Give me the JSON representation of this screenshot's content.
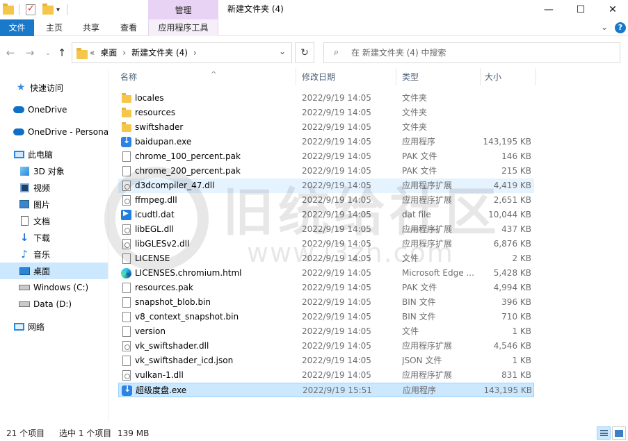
{
  "window": {
    "title": "新建文件夹 (4)",
    "context_tab": "管理",
    "minimize": "—",
    "maximize": "☐",
    "close": "✕"
  },
  "ribbon": {
    "tabs": [
      "文件",
      "主页",
      "共享",
      "查看",
      "应用程序工具"
    ],
    "expand_icon": "chevron-down-icon",
    "help_label": "?"
  },
  "address": {
    "crumbs": [
      "«",
      "桌面",
      "›",
      "新建文件夹 (4)",
      "›"
    ],
    "search_placeholder": "在 新建文件夹 (4) 中搜索"
  },
  "nav": {
    "items": [
      {
        "label": "快速访问",
        "icon": "star-icon"
      },
      {
        "label": "OneDrive",
        "icon": "cloud-icon"
      },
      {
        "label": "OneDrive - Persona",
        "icon": "cloud-icon"
      },
      {
        "label": "此电脑",
        "icon": "computer-icon"
      },
      {
        "label": "3D 对象",
        "icon": "cube-icon"
      },
      {
        "label": "视频",
        "icon": "video-icon"
      },
      {
        "label": "图片",
        "icon": "picture-icon"
      },
      {
        "label": "文档",
        "icon": "document-icon"
      },
      {
        "label": "下载",
        "icon": "download-icon"
      },
      {
        "label": "音乐",
        "icon": "music-icon"
      },
      {
        "label": "桌面",
        "icon": "desktop-icon"
      },
      {
        "label": "Windows (C:)",
        "icon": "drive-icon"
      },
      {
        "label": "Data (D:)",
        "icon": "drive-icon"
      },
      {
        "label": "网络",
        "icon": "network-icon"
      }
    ],
    "selected": "桌面"
  },
  "columns": {
    "name": "名称",
    "date": "修改日期",
    "type": "类型",
    "size": "大小"
  },
  "files": [
    {
      "name": "locales",
      "date": "2022/9/19 14:05",
      "type": "文件夹",
      "size": "",
      "icon": "folder"
    },
    {
      "name": "resources",
      "date": "2022/9/19 14:05",
      "type": "文件夹",
      "size": "",
      "icon": "folder"
    },
    {
      "name": "swiftshader",
      "date": "2022/9/19 14:05",
      "type": "文件夹",
      "size": "",
      "icon": "folder"
    },
    {
      "name": "baidupan.exe",
      "date": "2022/9/19 14:05",
      "type": "应用程序",
      "size": "143,195 KB",
      "icon": "exe"
    },
    {
      "name": "chrome_100_percent.pak",
      "date": "2022/9/19 14:05",
      "type": "PAK 文件",
      "size": "146 KB",
      "icon": "file"
    },
    {
      "name": "chrome_200_percent.pak",
      "date": "2022/9/19 14:05",
      "type": "PAK 文件",
      "size": "215 KB",
      "icon": "file"
    },
    {
      "name": "d3dcompiler_47.dll",
      "date": "2022/9/19 14:05",
      "type": "应用程序扩展",
      "size": "4,419 KB",
      "icon": "dll"
    },
    {
      "name": "ffmpeg.dll",
      "date": "2022/9/19 14:05",
      "type": "应用程序扩展",
      "size": "2,651 KB",
      "icon": "dll"
    },
    {
      "name": "icudtl.dat",
      "date": "2022/9/19 14:05",
      "type": "dat file",
      "size": "10,044 KB",
      "icon": "dat"
    },
    {
      "name": "libEGL.dll",
      "date": "2022/9/19 14:05",
      "type": "应用程序扩展",
      "size": "437 KB",
      "icon": "dll"
    },
    {
      "name": "libGLESv2.dll",
      "date": "2022/9/19 14:05",
      "type": "应用程序扩展",
      "size": "6,876 KB",
      "icon": "dll"
    },
    {
      "name": "LICENSE",
      "date": "2022/9/19 14:05",
      "type": "文件",
      "size": "2 KB",
      "icon": "file"
    },
    {
      "name": "LICENSES.chromium.html",
      "date": "2022/9/19 14:05",
      "type": "Microsoft Edge ...",
      "size": "5,428 KB",
      "icon": "edge"
    },
    {
      "name": "resources.pak",
      "date": "2022/9/19 14:05",
      "type": "PAK 文件",
      "size": "4,994 KB",
      "icon": "file"
    },
    {
      "name": "snapshot_blob.bin",
      "date": "2022/9/19 14:05",
      "type": "BIN 文件",
      "size": "396 KB",
      "icon": "file"
    },
    {
      "name": "v8_context_snapshot.bin",
      "date": "2022/9/19 14:05",
      "type": "BIN 文件",
      "size": "710 KB",
      "icon": "file"
    },
    {
      "name": "version",
      "date": "2022/9/19 14:05",
      "type": "文件",
      "size": "1 KB",
      "icon": "file"
    },
    {
      "name": "vk_swiftshader.dll",
      "date": "2022/9/19 14:05",
      "type": "应用程序扩展",
      "size": "4,546 KB",
      "icon": "dll"
    },
    {
      "name": "vk_swiftshader_icd.json",
      "date": "2022/9/19 14:05",
      "type": "JSON 文件",
      "size": "1 KB",
      "icon": "file"
    },
    {
      "name": "vulkan-1.dll",
      "date": "2022/9/19 14:05",
      "type": "应用程序扩展",
      "size": "831 KB",
      "icon": "dll"
    },
    {
      "name": "超级度盘.exe",
      "date": "2022/9/19 15:51",
      "type": "应用程序",
      "size": "143,195 KB",
      "icon": "exe"
    }
  ],
  "hover_row": 6,
  "selected_row": 20,
  "watermark": {
    "text": "旧统给社区",
    "url": "www.i3zh.com"
  },
  "status": {
    "count": "21 个项目",
    "selection": "选中 1 个项目",
    "size": "139 MB"
  }
}
